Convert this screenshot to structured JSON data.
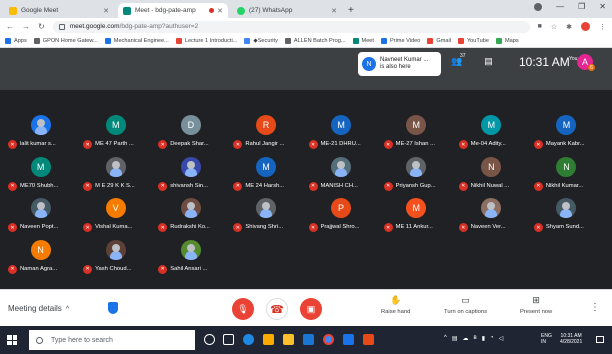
{
  "browser": {
    "tabs": [
      {
        "title": "Google Meet",
        "active": false,
        "icon_color": "#fbbc04"
      },
      {
        "title": "Meet - bdg-pate-amp",
        "active": true,
        "icon_color": "#00897b"
      },
      {
        "title": "(27) WhatsApp",
        "active": false,
        "icon_color": "#25d366"
      }
    ],
    "url_host": "meet.google.com",
    "url_path": "/bdg-pate-amp?authuser=2",
    "profile_initial": "A",
    "bookmarks": [
      {
        "label": "Apps",
        "color": "#1a73e8"
      },
      {
        "label": "GPON Home Gatew...",
        "color": "#5f6368"
      },
      {
        "label": "Mechanical Enginee...",
        "color": "#1a73e8"
      },
      {
        "label": "Lecture 1 Introducti...",
        "color": "#ea4335"
      },
      {
        "label": "◆Security",
        "color": "#4285f4"
      },
      {
        "label": "ALLEN Batch Prog...",
        "color": "#5f6368"
      },
      {
        "label": "Meet",
        "color": "#00897b"
      },
      {
        "label": "Prime Video",
        "color": "#1a73e8"
      },
      {
        "label": "Gmail",
        "color": "#ea4335"
      },
      {
        "label": "YouTube",
        "color": "#ea4335"
      },
      {
        "label": "Maps",
        "color": "#34a853"
      }
    ]
  },
  "meet": {
    "notification": {
      "initial": "N",
      "line1": "Navneet Kumar ...",
      "line2": "is also here"
    },
    "people_count": "37",
    "time": "10:31 AM",
    "you_label": "You",
    "you_initial": "A",
    "you_badge": "6",
    "participants": [
      {
        "name": "lalit kumar s...",
        "initial": "",
        "color": "#1a73e8",
        "photo": true
      },
      {
        "name": "ME 47 Parth ...",
        "initial": "M",
        "color": "#00897b",
        "photo": false
      },
      {
        "name": "Deepak Shar...",
        "initial": "D",
        "color": "#78909c",
        "photo": false
      },
      {
        "name": "Rahul Jangir ...",
        "initial": "R",
        "color": "#e64a19",
        "photo": false
      },
      {
        "name": "ME-21 DHRU...",
        "initial": "M",
        "color": "#1565c0",
        "photo": false
      },
      {
        "name": "ME-27 Ishan ...",
        "initial": "M",
        "color": "#795548",
        "photo": false
      },
      {
        "name": "Me-04 Adity...",
        "initial": "M",
        "color": "#0097a7",
        "photo": false
      },
      {
        "name": "Mayank Kabr...",
        "initial": "M",
        "color": "#1565c0",
        "photo": false
      },
      {
        "name": "ME70 Shubh...",
        "initial": "M",
        "color": "#00897b",
        "photo": false
      },
      {
        "name": "M E 29 K K S...",
        "initial": "",
        "color": "#5f6368",
        "photo": true
      },
      {
        "name": "shivansh Sin...",
        "initial": "",
        "color": "#3949ab",
        "photo": true
      },
      {
        "name": "ME 24 Harsh...",
        "initial": "M",
        "color": "#1565c0",
        "photo": false
      },
      {
        "name": "MANISH CH...",
        "initial": "",
        "color": "#546e7a",
        "photo": true
      },
      {
        "name": "Priyansh Gup...",
        "initial": "",
        "color": "#5f6368",
        "photo": true
      },
      {
        "name": "Nikhil Nuwal ...",
        "initial": "N",
        "color": "#795548",
        "photo": false
      },
      {
        "name": "Nikhil Kumar...",
        "initial": "N",
        "color": "#2e7d32",
        "photo": false
      },
      {
        "name": "Naveen Popt...",
        "initial": "",
        "color": "#455a64",
        "photo": true
      },
      {
        "name": "Vishal Kuma...",
        "initial": "V",
        "color": "#f57c00",
        "photo": false
      },
      {
        "name": "Rudrakshi Ko...",
        "initial": "",
        "color": "#6d4c41",
        "photo": true
      },
      {
        "name": "Shivang Shri...",
        "initial": "",
        "color": "#5f6368",
        "photo": true
      },
      {
        "name": "Prajjwal Shro...",
        "initial": "P",
        "color": "#e64a19",
        "photo": false
      },
      {
        "name": "ME 11 Ankur...",
        "initial": "M",
        "color": "#f4511e",
        "photo": false
      },
      {
        "name": "Naveen Ver...",
        "initial": "",
        "color": "#8d6e63",
        "photo": true
      },
      {
        "name": "Shyam Sund...",
        "initial": "",
        "color": "#455a64",
        "photo": true
      },
      {
        "name": "Naman Agra...",
        "initial": "N",
        "color": "#f57c00",
        "photo": false
      },
      {
        "name": "Yash Choud...",
        "initial": "",
        "color": "#5d4037",
        "photo": true
      },
      {
        "name": "Sahil Ansari ...",
        "initial": "",
        "color": "#558b2f",
        "photo": true
      }
    ],
    "bottom": {
      "meeting_details": "Meeting details",
      "raise_hand": "Raise hand",
      "captions": "Turn on captions",
      "present": "Present now"
    }
  },
  "taskbar": {
    "search_placeholder": "Type here to search",
    "lang1": "ENG",
    "lang2": "IN",
    "time": "10:31 AM",
    "date": "4/28/2021"
  }
}
